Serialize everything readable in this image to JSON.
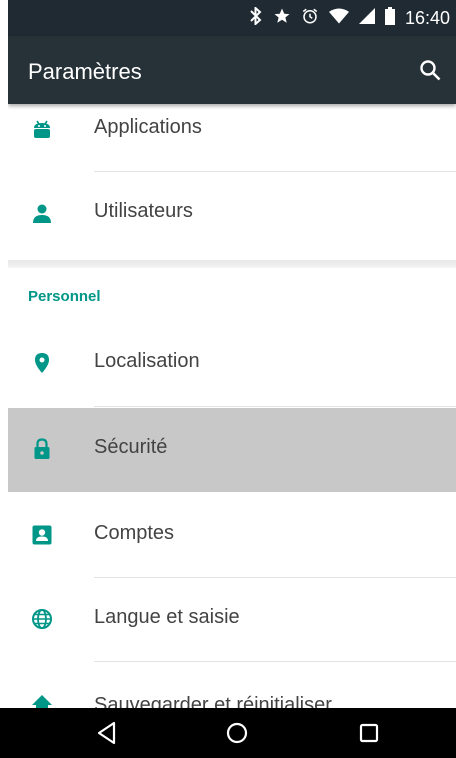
{
  "status_bar": {
    "time": "16:40",
    "icons": [
      "bluetooth-icon",
      "star-icon",
      "alarm-icon",
      "wifi-icon",
      "signal-icon",
      "battery-icon"
    ]
  },
  "toolbar": {
    "title": "Paramètres",
    "search_icon": "search-icon"
  },
  "items_top": [
    {
      "label": "Applications",
      "icon": "android-icon"
    },
    {
      "label": "Utilisateurs",
      "icon": "person-icon"
    }
  ],
  "section_personnel": {
    "title": "Personnel"
  },
  "items_personnel": [
    {
      "label": "Localisation",
      "icon": "location-icon"
    },
    {
      "label": "Sécurité",
      "icon": "lock-icon"
    },
    {
      "label": "Comptes",
      "icon": "account-box-icon"
    },
    {
      "label": "Langue et saisie",
      "icon": "globe-icon"
    },
    {
      "label": "Sauvegarder et réinitialiser",
      "icon": "backup-icon"
    }
  ],
  "nav_bar": {
    "icons": [
      "back-icon",
      "home-icon",
      "recents-icon"
    ]
  },
  "colors": {
    "accent": "#009688",
    "toolbar": "#263238",
    "statusbar": "#1f2a33",
    "selected_row": "#c8c8c8"
  }
}
